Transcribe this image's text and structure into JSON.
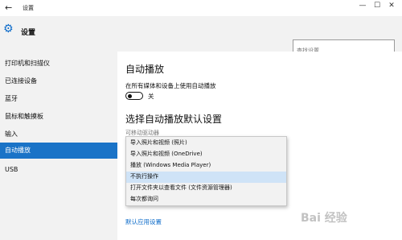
{
  "window": {
    "back_glyph": "←",
    "title": "设置",
    "controls": [
      "—",
      "☐",
      "✕"
    ]
  },
  "header": {
    "icon": "gear-icon",
    "title": "设置",
    "search_placeholder": "查找设置"
  },
  "sidebar": {
    "items": [
      {
        "label": "打印机和扫描仪",
        "active": false
      },
      {
        "label": "已连接设备",
        "active": false
      },
      {
        "label": "蓝牙",
        "active": false
      },
      {
        "label": "鼠标和触摸板",
        "active": false
      },
      {
        "label": "输入",
        "active": false
      },
      {
        "label": "自动播放",
        "active": true
      },
      {
        "label": "USB",
        "active": false
      }
    ]
  },
  "main": {
    "heading": "自动播放",
    "toggle_description": "在所有媒体和设备上使用自动播放",
    "toggle_state": "关",
    "section_heading": "选择自动播放默认设置",
    "sublabel": "可移动驱动器",
    "dropdown_options": [
      {
        "label": "导入照片和视频 (照片)",
        "selected": false
      },
      {
        "label": "导入照片和视频 (OneDrive)",
        "selected": false
      },
      {
        "label": "播放 (Windows Media Player)",
        "selected": false
      },
      {
        "label": "不执行操作",
        "selected": true
      },
      {
        "label": "打开文件夹以查看文件 (文件资源管理器)",
        "selected": false
      },
      {
        "label": "每次都询问",
        "selected": false
      }
    ],
    "link": "默认应用设置"
  },
  "watermark": "Bai 经验",
  "colors": {
    "accent": "#1a73c7",
    "link": "#0a6ac9",
    "sidebar_bg": "#f2f2f2",
    "selected_option_bg": "#cfe3f7"
  }
}
